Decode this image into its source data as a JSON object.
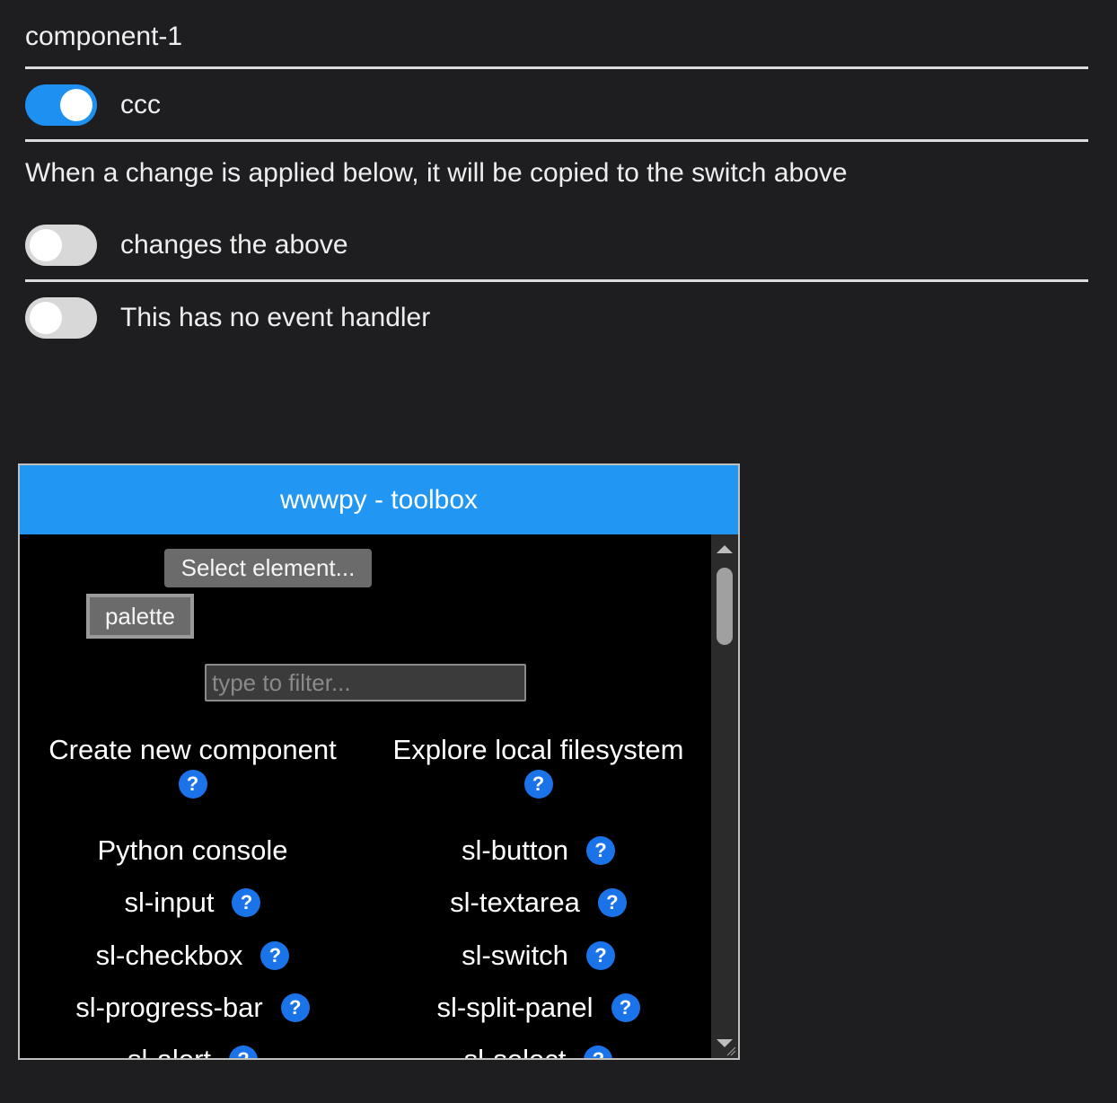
{
  "header": {
    "title": "component-1"
  },
  "switches": [
    {
      "label": "ccc",
      "checked": true
    },
    {
      "label": "changes the above",
      "checked": false
    },
    {
      "label": "This has no event handler",
      "checked": false
    }
  ],
  "note": "When a change is applied below, it will be copied to the switch above",
  "toolbox": {
    "title": "wwwpy - toolbox",
    "select_button": "Select element...",
    "palette_button": "palette",
    "filter_placeholder": "type to filter...",
    "filter_value": "",
    "items": [
      {
        "label": "Create new component",
        "help": "?"
      },
      {
        "label": "Explore local filesystem",
        "help": "?"
      },
      {
        "label": "Python console"
      },
      {
        "label": "sl-button",
        "help": "?"
      },
      {
        "label": "sl-input",
        "help": "?"
      },
      {
        "label": "sl-textarea",
        "help": "?"
      },
      {
        "label": "sl-checkbox",
        "help": "?"
      },
      {
        "label": "sl-switch",
        "help": "?"
      },
      {
        "label": "sl-progress-bar",
        "help": "?"
      },
      {
        "label": "sl-split-panel",
        "help": "?"
      },
      {
        "label": "sl-alert",
        "help": "?"
      },
      {
        "label": "sl-select",
        "help": "?"
      }
    ]
  },
  "colors": {
    "background": "#1e1e21",
    "accent": "#2196f3",
    "switch_on": "#1e90f2",
    "help_badge": "#1a73e8"
  },
  "icons": {
    "help": "question-circle-icon",
    "scroll_up": "triangle-up-icon",
    "scroll_down": "triangle-down-icon",
    "resize": "resize-grip-icon"
  }
}
